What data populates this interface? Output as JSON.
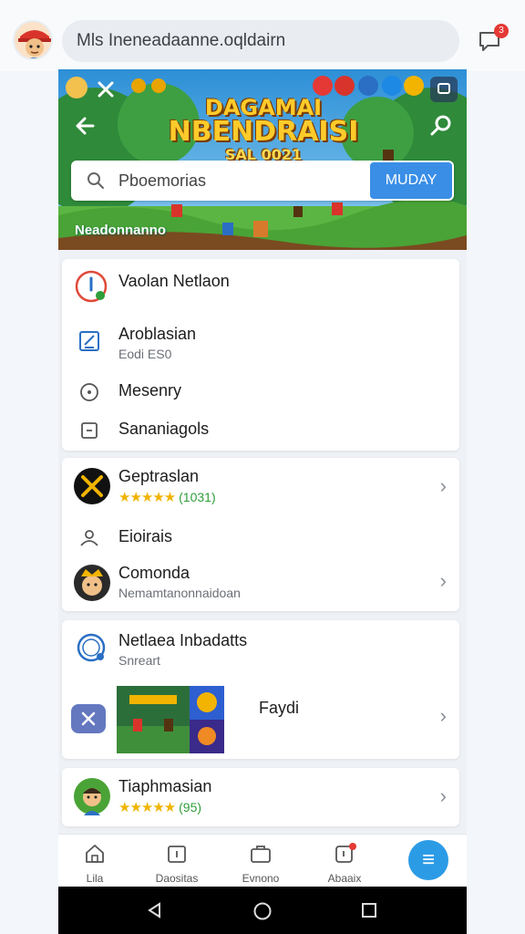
{
  "top": {
    "search_text": "Mls Ineneadaanne.oqldairn",
    "notification_count": "3"
  },
  "banner": {
    "title_line1": "DAGAMAI",
    "title_line2": "NBENDRAISI",
    "title_line3": "SAL 0021",
    "search_placeholder": "Pboemorias",
    "search_button": "MUDAY",
    "caption": "Neadonnanno"
  },
  "card1": {
    "header": "Vaolan Netlaon",
    "items": [
      {
        "label": "Aroblasian",
        "sub": "Eodi ES0"
      },
      {
        "label": "Mesenry"
      },
      {
        "label": "Sananiagols"
      }
    ]
  },
  "card2": {
    "item1": {
      "label": "Geptraslan",
      "rating": "★★★★★",
      "count": "(1031)"
    },
    "item2": {
      "label": "Eioirais"
    },
    "item3": {
      "label": "Comonda",
      "sub": "Nemamtanonnaidoan"
    }
  },
  "card3": {
    "header": "Netlaea Inbadatts",
    "sub": "Snreart",
    "media_label": "Faydi"
  },
  "card4": {
    "label": "Tiaphmasian",
    "rating": "★★★★★",
    "count": "(95)"
  },
  "nav": {
    "items": [
      {
        "label": "Lila",
        "icon": "home-icon"
      },
      {
        "label": "Daositas",
        "icon": "calendar-icon"
      },
      {
        "label": "Evnono",
        "icon": "briefcase-icon"
      },
      {
        "label": "Abaaix",
        "icon": "alert-icon"
      }
    ],
    "fab_icon": "≡"
  },
  "colors": {
    "accent": "#2c9be6",
    "button": "#3a8ee6",
    "star": "#f0b400"
  }
}
